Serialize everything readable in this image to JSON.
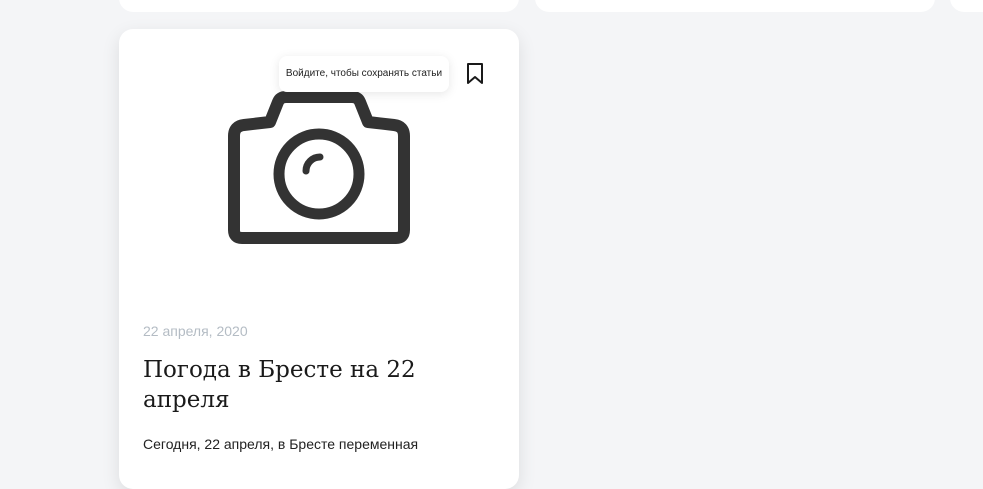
{
  "article": {
    "image_placeholder_icon": "camera-icon",
    "tooltip": "Войдите, чтобы сохранять статьи",
    "bookmark_icon": "bookmark-icon",
    "date": "22 апреля, 2020",
    "title": "Погода в Бресте на 22 апреля",
    "excerpt": "Сегодня, 22 апреля, в Бресте переменная"
  }
}
